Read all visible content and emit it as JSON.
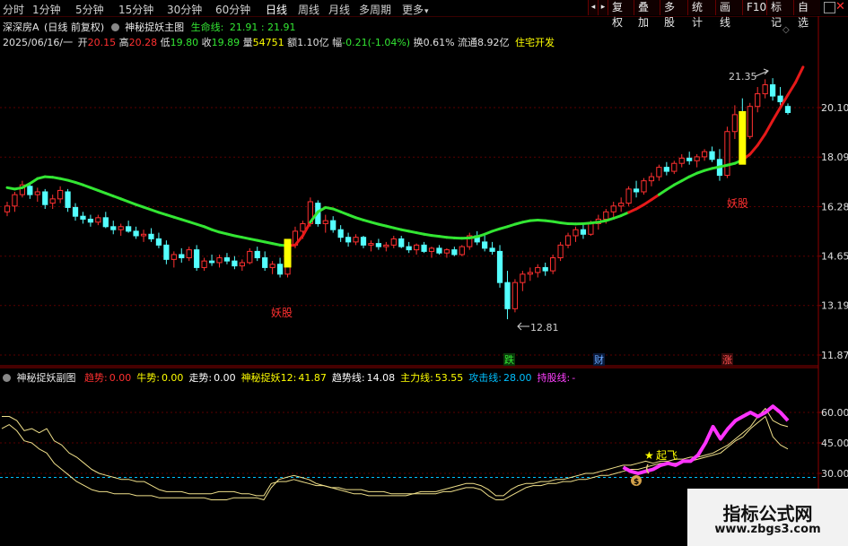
{
  "toolbar": {
    "periods": [
      "分时",
      "1分钟",
      "5分钟",
      "15分钟",
      "30分钟",
      "60分钟",
      "日线",
      "周线",
      "月线",
      "多周期",
      "更多"
    ],
    "more_arrow": "▾",
    "active_period": "日线",
    "right_buttons": [
      "复权",
      "叠加",
      "多股",
      "统计",
      "画线",
      "F10",
      "标记",
      "自选"
    ],
    "nav_left": "◂",
    "nav_right": "▸"
  },
  "main_header": {
    "stock": "深深房A",
    "mode": "(日线 前复权)",
    "indicator": "神秘捉妖主图",
    "life_line_label": "生命线:",
    "life_line_value": "21.91 : 21.91"
  },
  "quote_line": {
    "date": "2025/06/16/一",
    "open_label": "开",
    "open": "20.15",
    "high_label": "高",
    "high": "20.28",
    "low_label": "低",
    "low": "19.80",
    "close_label": "收",
    "close": "19.89",
    "vol_label": "量",
    "vol": "54751",
    "amount_label": "额",
    "amount": "1.10亿",
    "change_label": "幅",
    "change": "-0.21(-1.04%)",
    "turnover_label": "换",
    "turnover": "0.61%",
    "float_label": "流通",
    "float": "8.92亿",
    "industry": "住宅开发"
  },
  "price_axis": [
    "20.10",
    "18.09",
    "16.28",
    "14.65",
    "13.19",
    "11.87"
  ],
  "main_annotations": {
    "high_price": "21.35",
    "low_price": "12.81",
    "demon1": "妖股",
    "demon2": "妖股",
    "events": [
      "跌",
      "财",
      "涨"
    ]
  },
  "sub_header": {
    "name": "神秘捉妖副图",
    "items": [
      {
        "label": "趋势:",
        "value": "0.00",
        "color": "#ff3030"
      },
      {
        "label": "牛势:",
        "value": "0.00",
        "color": "#ffff00"
      },
      {
        "label": "走势:",
        "value": "0.00",
        "color": "#ffffff"
      },
      {
        "label": "神秘捉妖12:",
        "value": "41.87",
        "color": "#ffff00"
      },
      {
        "label": "趋势线:",
        "value": "14.08",
        "color": "#ffffff"
      },
      {
        "label": "主力线:",
        "value": "53.55",
        "color": "#ffff00"
      },
      {
        "label": "攻击线:",
        "value": "28.00",
        "color": "#00c0ff"
      },
      {
        "label": "持股线:",
        "value": "-",
        "color": "#ff40ff"
      }
    ]
  },
  "sub_axis": [
    "60.00",
    "45.00",
    "30.00"
  ],
  "sub_annotations": {
    "takeoff": "起飞",
    "money": "$"
  },
  "watermark": {
    "line1": "指标公式网",
    "line2": "www.zbgs3.com"
  },
  "colors": {
    "up": "#ff3030",
    "down": "#54ffff",
    "life_line_green": "#33e633",
    "life_line_red": "#e61919",
    "demon_bar": "#ffff00",
    "hold_line": "#ff33ff",
    "attack_line": "#00c0ff"
  },
  "chart_data": [
    {
      "type": "candlestick",
      "title": "神秘捉妖主图",
      "ylim": [
        11.87,
        22.2
      ],
      "y_scale": "log",
      "y_ticks": [
        20.1,
        18.09,
        16.28,
        14.65,
        13.19,
        11.87
      ],
      "candles": [
        [
          16.1,
          16.45,
          15.95,
          16.3
        ],
        [
          16.3,
          16.8,
          16.1,
          16.7
        ],
        [
          16.7,
          17.2,
          16.6,
          17.05
        ],
        [
          17.0,
          17.1,
          16.55,
          16.7
        ],
        [
          16.7,
          16.95,
          16.45,
          16.8
        ],
        [
          16.8,
          16.9,
          16.2,
          16.35
        ],
        [
          16.4,
          16.7,
          16.2,
          16.55
        ],
        [
          16.55,
          17.0,
          16.4,
          16.85
        ],
        [
          16.8,
          16.9,
          16.1,
          16.25
        ],
        [
          16.25,
          16.4,
          15.8,
          15.95
        ],
        [
          15.95,
          16.1,
          15.7,
          15.85
        ],
        [
          15.85,
          16.0,
          15.6,
          15.75
        ],
        [
          15.75,
          16.0,
          15.65,
          15.9
        ],
        [
          15.9,
          16.1,
          15.55,
          15.6
        ],
        [
          15.6,
          15.8,
          15.35,
          15.5
        ],
        [
          15.5,
          15.7,
          15.3,
          15.6
        ],
        [
          15.6,
          15.8,
          15.4,
          15.45
        ],
        [
          15.45,
          15.6,
          15.2,
          15.3
        ],
        [
          15.3,
          15.5,
          15.1,
          15.35
        ],
        [
          15.35,
          15.55,
          15.1,
          15.2
        ],
        [
          15.2,
          15.4,
          14.9,
          15.0
        ],
        [
          15.0,
          15.15,
          14.4,
          14.55
        ],
        [
          14.55,
          14.8,
          14.3,
          14.7
        ],
        [
          14.7,
          14.9,
          14.45,
          14.6
        ],
        [
          14.6,
          14.95,
          14.5,
          14.85
        ],
        [
          14.85,
          15.0,
          14.2,
          14.3
        ],
        [
          14.3,
          14.6,
          14.2,
          14.5
        ],
        [
          14.5,
          14.7,
          14.35,
          14.45
        ],
        [
          14.45,
          14.7,
          14.3,
          14.6
        ],
        [
          14.6,
          14.75,
          14.4,
          14.5
        ],
        [
          14.5,
          14.65,
          14.25,
          14.35
        ],
        [
          14.35,
          14.55,
          14.2,
          14.45
        ],
        [
          14.45,
          14.9,
          14.4,
          14.8
        ],
        [
          14.8,
          14.95,
          14.5,
          14.6
        ],
        [
          14.6,
          14.8,
          14.2,
          14.3
        ],
        [
          14.3,
          14.5,
          14.1,
          14.4
        ],
        [
          14.4,
          14.6,
          14.0,
          14.1
        ],
        [
          14.1,
          15.1,
          14.0,
          15.0
        ],
        [
          15.0,
          15.6,
          14.9,
          15.45
        ],
        [
          15.45,
          15.8,
          15.2,
          15.7
        ],
        [
          15.7,
          16.6,
          15.6,
          16.45
        ],
        [
          16.4,
          16.5,
          15.6,
          15.7
        ],
        [
          15.7,
          16.0,
          15.4,
          15.8
        ],
        [
          15.8,
          15.95,
          15.4,
          15.5
        ],
        [
          15.5,
          15.65,
          15.1,
          15.25
        ],
        [
          15.25,
          15.4,
          14.95,
          15.1
        ],
        [
          15.1,
          15.35,
          15.0,
          15.25
        ],
        [
          15.25,
          15.3,
          14.9,
          15.0
        ],
        [
          15.0,
          15.15,
          14.8,
          15.05
        ],
        [
          15.05,
          15.2,
          14.85,
          14.95
        ],
        [
          14.95,
          15.1,
          14.8,
          15.0
        ],
        [
          15.0,
          15.3,
          14.9,
          15.2
        ],
        [
          15.2,
          15.3,
          14.9,
          14.95
        ],
        [
          14.95,
          15.1,
          14.75,
          14.85
        ],
        [
          14.85,
          15.05,
          14.7,
          15.0
        ],
        [
          15.0,
          15.1,
          14.75,
          14.8
        ],
        [
          14.8,
          14.95,
          14.6,
          14.9
        ],
        [
          14.9,
          15.0,
          14.7,
          14.75
        ],
        [
          14.75,
          14.9,
          14.6,
          14.85
        ],
        [
          14.85,
          14.95,
          14.65,
          14.7
        ],
        [
          14.7,
          15.0,
          14.65,
          14.95
        ],
        [
          14.95,
          15.4,
          14.85,
          15.3
        ],
        [
          15.3,
          15.45,
          15.0,
          15.1
        ],
        [
          15.1,
          15.3,
          14.8,
          14.9
        ],
        [
          14.9,
          15.1,
          14.7,
          14.8
        ],
        [
          14.8,
          15.0,
          13.7,
          13.85
        ],
        [
          13.85,
          14.2,
          12.81,
          13.1
        ],
        [
          13.1,
          13.95,
          13.0,
          13.85
        ],
        [
          13.85,
          14.2,
          13.6,
          14.1
        ],
        [
          14.1,
          14.3,
          13.9,
          14.15
        ],
        [
          14.15,
          14.4,
          14.0,
          14.3
        ],
        [
          14.3,
          14.45,
          14.05,
          14.2
        ],
        [
          14.2,
          14.7,
          14.1,
          14.6
        ],
        [
          14.6,
          15.1,
          14.5,
          15.0
        ],
        [
          15.0,
          15.4,
          14.9,
          15.3
        ],
        [
          15.3,
          15.6,
          15.1,
          15.5
        ],
        [
          15.5,
          15.7,
          15.2,
          15.35
        ],
        [
          15.35,
          15.8,
          15.3,
          15.7
        ],
        [
          15.7,
          16.0,
          15.5,
          15.85
        ],
        [
          15.85,
          16.2,
          15.7,
          16.1
        ],
        [
          16.1,
          16.45,
          15.9,
          16.3
        ],
        [
          16.3,
          16.6,
          16.1,
          16.4
        ],
        [
          16.4,
          17.0,
          16.3,
          16.9
        ],
        [
          16.9,
          17.2,
          16.6,
          16.8
        ],
        [
          16.8,
          17.3,
          16.7,
          17.2
        ],
        [
          17.2,
          17.5,
          17.0,
          17.35
        ],
        [
          17.35,
          17.8,
          17.2,
          17.7
        ],
        [
          17.7,
          17.9,
          17.4,
          17.55
        ],
        [
          17.55,
          17.95,
          17.45,
          17.85
        ],
        [
          17.85,
          18.2,
          17.7,
          18.05
        ],
        [
          18.05,
          18.3,
          17.8,
          17.95
        ],
        [
          17.95,
          18.2,
          17.7,
          18.1
        ],
        [
          18.1,
          18.4,
          17.95,
          18.3
        ],
        [
          18.3,
          18.5,
          17.9,
          18.0
        ],
        [
          18.0,
          18.4,
          17.2,
          17.4
        ],
        [
          17.4,
          19.3,
          17.3,
          19.1
        ],
        [
          19.1,
          20.2,
          18.8,
          19.8
        ],
        [
          19.8,
          20.5,
          18.6,
          18.9
        ],
        [
          18.9,
          20.3,
          18.8,
          20.15
        ],
        [
          20.15,
          21.0,
          19.9,
          20.7
        ],
        [
          20.7,
          21.35,
          20.5,
          21.1
        ],
        [
          21.1,
          21.4,
          20.4,
          20.6
        ],
        [
          20.6,
          21.0,
          20.2,
          20.35
        ],
        [
          20.15,
          20.28,
          19.8,
          19.89
        ]
      ],
      "life_line": [
        16.95,
        16.9,
        16.95,
        17.1,
        17.28,
        17.35,
        17.33,
        17.28,
        17.22,
        17.14,
        17.05,
        16.95,
        16.85,
        16.75,
        16.65,
        16.55,
        16.45,
        16.35,
        16.26,
        16.17,
        16.08,
        16.0,
        15.92,
        15.84,
        15.76,
        15.68,
        15.6,
        15.5,
        15.42,
        15.36,
        15.3,
        15.25,
        15.2,
        15.15,
        15.1,
        15.05,
        15.0,
        14.98,
        15.0,
        15.3,
        15.75,
        16.1,
        16.25,
        16.2,
        16.1,
        16.0,
        15.9,
        15.82,
        15.75,
        15.68,
        15.62,
        15.56,
        15.5,
        15.45,
        15.4,
        15.35,
        15.31,
        15.28,
        15.25,
        15.23,
        15.22,
        15.23,
        15.27,
        15.35,
        15.45,
        15.53,
        15.6,
        15.68,
        15.75,
        15.8,
        15.82,
        15.8,
        15.77,
        15.73,
        15.7,
        15.69,
        15.7,
        15.72,
        15.75,
        15.8,
        15.88,
        15.97,
        16.08,
        16.2,
        16.35,
        16.52,
        16.7,
        16.88,
        17.05,
        17.2,
        17.35,
        17.48,
        17.58,
        17.66,
        17.72,
        17.78,
        17.85,
        17.98,
        18.2,
        18.55,
        19.0,
        19.55,
        20.1,
        20.65,
        21.2,
        21.91
      ],
      "demon_bars": [
        [
          37,
          14.3,
          15.2
        ],
        [
          97,
          17.8,
          19.95
        ]
      ]
    },
    {
      "type": "line",
      "title": "神秘捉妖副图",
      "ylim": [
        17,
        68
      ],
      "y_ticks": [
        60,
        45,
        30
      ],
      "reference_line": 28,
      "series": [
        {
          "name": "主力线",
          "values": [
            58,
            58,
            56,
            51,
            52,
            50,
            52,
            46,
            44,
            40,
            38,
            35,
            32,
            30,
            29,
            28,
            27,
            27,
            26,
            26,
            24,
            22,
            21,
            21,
            21,
            20,
            20,
            20,
            20,
            21,
            21,
            21,
            20,
            20,
            19,
            19,
            25,
            26,
            26,
            27,
            26,
            25,
            24,
            24,
            23,
            23,
            22,
            22,
            22,
            21,
            21,
            21,
            20,
            20,
            20,
            20,
            21,
            21,
            21,
            22,
            23,
            24,
            25,
            25,
            24,
            22,
            19,
            19,
            22,
            24,
            25,
            25,
            26,
            26,
            27,
            27,
            28,
            29,
            30,
            30,
            31,
            32,
            33,
            34,
            34,
            35,
            36,
            35,
            36,
            36,
            37,
            37,
            38,
            38,
            39,
            40,
            42,
            44,
            47,
            50,
            53,
            58,
            62,
            56,
            54,
            53
          ]
        },
        {
          "name": "神秘捉妖12",
          "values": [
            52,
            54,
            51,
            46,
            45,
            42,
            40,
            35,
            32,
            29,
            26,
            24,
            22,
            21,
            21,
            20,
            20,
            20,
            19,
            19,
            19,
            18,
            18,
            18,
            18,
            18,
            18,
            18,
            17,
            17,
            17,
            18,
            18,
            18,
            18,
            17,
            23,
            27,
            28,
            29,
            28,
            27,
            25,
            24,
            23,
            22,
            21,
            20,
            20,
            19,
            19,
            19,
            19,
            19,
            19,
            20,
            20,
            20,
            20,
            21,
            21,
            22,
            23,
            23,
            22,
            19,
            17,
            17,
            19,
            21,
            23,
            24,
            24,
            25,
            25,
            26,
            26,
            27,
            27,
            28,
            29,
            29,
            30,
            31,
            32,
            32,
            33,
            34,
            35,
            35,
            35,
            36,
            36,
            37,
            38,
            39,
            40,
            43,
            46,
            48,
            52,
            55,
            58,
            48,
            44,
            42
          ]
        },
        {
          "name": "持股线",
          "values": [
            33,
            31,
            30,
            31,
            32,
            34,
            35,
            34,
            36,
            36,
            39,
            45,
            53,
            47,
            52,
            56,
            58,
            60,
            58,
            60,
            63,
            60,
            56
          ]
        }
      ]
    }
  ]
}
